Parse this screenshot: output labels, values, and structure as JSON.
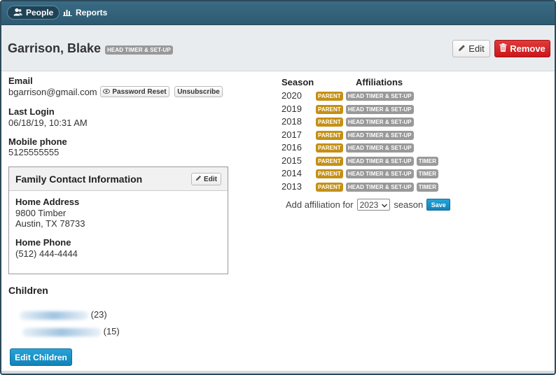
{
  "nav": {
    "people_label": "People",
    "people_icon": "users-icon",
    "reports_label": "Reports",
    "reports_icon": "bar-chart-icon"
  },
  "person": {
    "name": "Garrison, Blake",
    "role_tag": "HEAD TIMER & SET-UP"
  },
  "header_actions": {
    "edit_label": "Edit",
    "remove_label": "Remove"
  },
  "contact": {
    "email_label": "Email",
    "email_value": "bgarrison@gmail.com",
    "password_reset_label": "Password Reset",
    "unsubscribe_label": "Unsubscribe",
    "last_login_label": "Last Login",
    "last_login_value": "06/18/19, 10:31 AM",
    "mobile_label": "Mobile phone",
    "mobile_value": "5125555555"
  },
  "family": {
    "title": "Family Contact Information",
    "edit_label": "Edit",
    "home_address_label": "Home Address",
    "address_line1": "9800 Timber",
    "address_line2": "Austin, TX 78733",
    "home_phone_label": "Home Phone",
    "home_phone_value": "(512) 444-4444"
  },
  "children": {
    "title": "Children",
    "items": [
      {
        "age": "(23)"
      },
      {
        "age": "(15)"
      }
    ],
    "edit_label": "Edit Children"
  },
  "affiliations": {
    "season_header": "Season",
    "affiliations_header": "Affiliations",
    "rows": [
      {
        "season": "2020",
        "tags": [
          "PARENT",
          "HEAD TIMER & SET-UP"
        ]
      },
      {
        "season": "2019",
        "tags": [
          "PARENT",
          "HEAD TIMER & SET-UP"
        ]
      },
      {
        "season": "2018",
        "tags": [
          "PARENT",
          "HEAD TIMER & SET-UP"
        ]
      },
      {
        "season": "2017",
        "tags": [
          "PARENT",
          "HEAD TIMER & SET-UP"
        ]
      },
      {
        "season": "2016",
        "tags": [
          "PARENT",
          "HEAD TIMER & SET-UP"
        ]
      },
      {
        "season": "2015",
        "tags": [
          "PARENT",
          "HEAD TIMER & SET-UP",
          "TIMER"
        ]
      },
      {
        "season": "2014",
        "tags": [
          "PARENT",
          "HEAD TIMER & SET-UP",
          "TIMER"
        ]
      },
      {
        "season": "2013",
        "tags": [
          "PARENT",
          "HEAD TIMER & SET-UP",
          "TIMER"
        ]
      }
    ],
    "add_label_pre": "Add affiliation for",
    "selected_season": "2023",
    "add_label_post": "season",
    "save_label": "Save"
  },
  "colors": {
    "parent_tag": "#c49016",
    "role_tag": "#999999",
    "remove_button": "#c9161a",
    "primary_button": "#1283b8",
    "nav_bar": "#2e5a71"
  }
}
